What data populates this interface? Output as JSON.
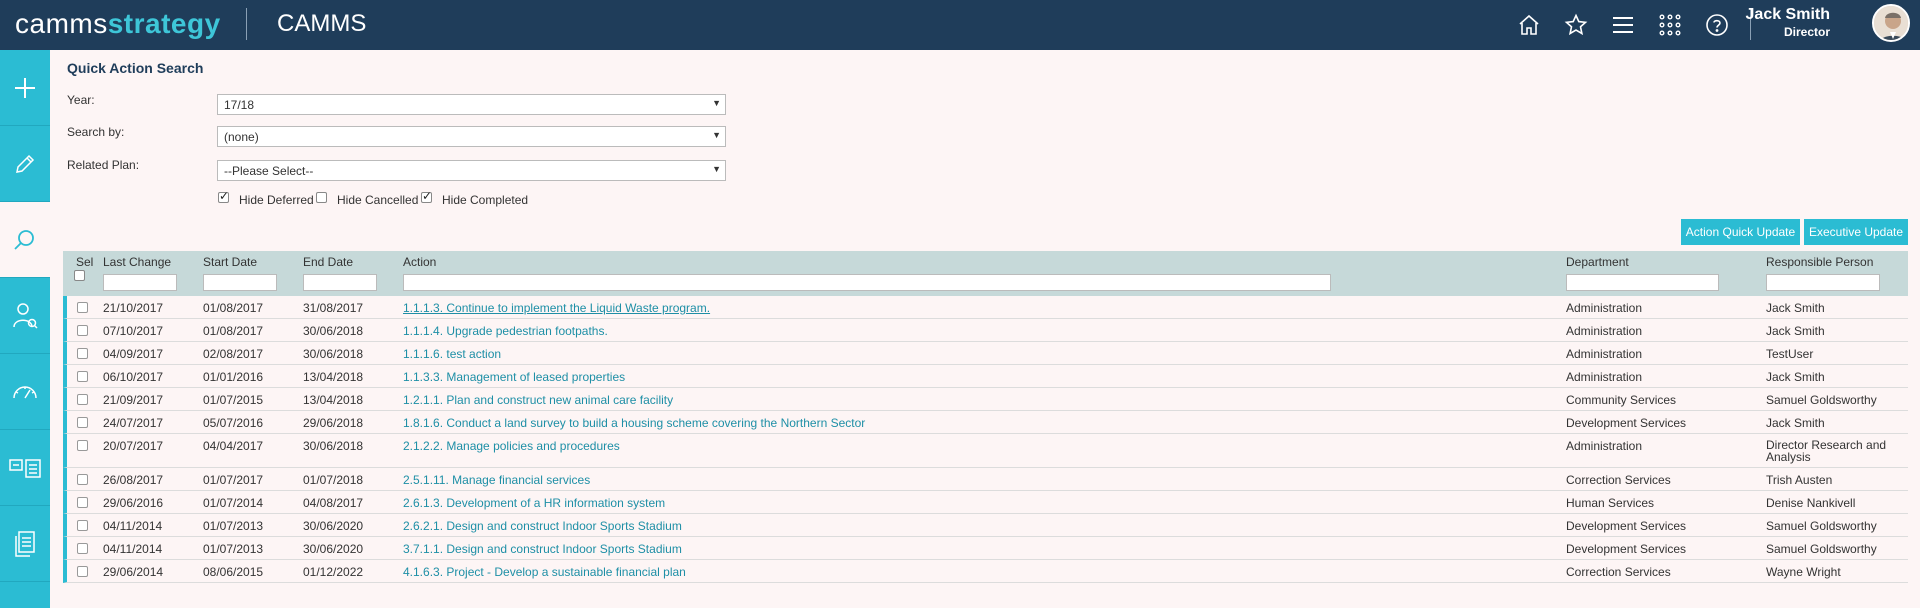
{
  "header": {
    "logo_part1": "camms",
    "logo_part2": "strategy",
    "app_title": "CAMMS",
    "user_name": "Jack Smith",
    "user_role": "Director"
  },
  "icons": {
    "top": [
      "home-icon",
      "star-icon",
      "menu-icon",
      "apps-grid-icon",
      "help-icon"
    ],
    "sidebar": [
      "plus-icon",
      "pencil-icon",
      "search-icon",
      "user-search-icon",
      "dashboard-gauge-icon",
      "report-cards-icon",
      "document-icon"
    ]
  },
  "colors": {
    "topbar": "#1f3d5a",
    "accent": "#2bbcd3",
    "link": "#1e8fa6"
  },
  "form": {
    "title": "Quick Action Search",
    "year_label": "Year:",
    "year_value": "17/18",
    "search_by_label": "Search by:",
    "search_by_value": "(none)",
    "related_plan_label": "Related Plan:",
    "related_plan_value": "--Please Select--",
    "hide_deferred": "Hide Deferred",
    "hide_cancelled": "Hide Cancelled",
    "hide_completed": "Hide Completed",
    "hide_deferred_checked": true,
    "hide_cancelled_checked": false,
    "hide_completed_checked": true
  },
  "buttons": {
    "action_quick_update": "Action Quick Update",
    "executive_update": "Executive Update"
  },
  "table": {
    "columns": {
      "sel": "Sel",
      "last_change": "Last Change",
      "start_date": "Start Date",
      "end_date": "End Date",
      "action": "Action",
      "department": "Department",
      "responsible": "Responsible Person"
    },
    "rows": [
      {
        "last_change": "21/10/2017",
        "start": "01/08/2017",
        "end": "31/08/2017",
        "action": "1.1.1.3. Continue to implement the Liquid Waste program.",
        "department": "Administration",
        "person": "Jack Smith"
      },
      {
        "last_change": "07/10/2017",
        "start": "01/08/2017",
        "end": "30/06/2018",
        "action": "1.1.1.4. Upgrade pedestrian footpaths.",
        "department": "Administration",
        "person": "Jack Smith"
      },
      {
        "last_change": "04/09/2017",
        "start": "02/08/2017",
        "end": "30/06/2018",
        "action": "1.1.1.6. test action",
        "department": "Administration",
        "person": "TestUser"
      },
      {
        "last_change": "06/10/2017",
        "start": "01/01/2016",
        "end": "13/04/2018",
        "action": "1.1.3.3. Management of leased properties",
        "department": "Administration",
        "person": "Jack Smith"
      },
      {
        "last_change": "21/09/2017",
        "start": "01/07/2015",
        "end": "13/04/2018",
        "action": "1.2.1.1. Plan and construct new animal care facility",
        "department": "Community Services",
        "person": "Samuel Goldsworthy"
      },
      {
        "last_change": "24/07/2017",
        "start": "05/07/2016",
        "end": "29/06/2018",
        "action": "1.8.1.6. Conduct a land survey to build a housing scheme covering the Northern Sector",
        "department": "Development Services",
        "person": "Jack Smith"
      },
      {
        "last_change": "20/07/2017",
        "start": "04/04/2017",
        "end": "30/06/2018",
        "action": "2.1.2.2. Manage policies and procedures",
        "department": "Administration",
        "person": "Director Research and Analysis"
      },
      {
        "last_change": "26/08/2017",
        "start": "01/07/2017",
        "end": "01/07/2018",
        "action": "2.5.1.11. Manage financial services",
        "department": "Correction Services",
        "person": "Trish Austen"
      },
      {
        "last_change": "29/06/2016",
        "start": "01/07/2014",
        "end": "04/08/2017",
        "action": "2.6.1.3. Development of a HR information system",
        "department": "Human Services",
        "person": "Denise Nankivell"
      },
      {
        "last_change": "04/11/2014",
        "start": "01/07/2013",
        "end": "30/06/2020",
        "action": "2.6.2.1. Design and construct Indoor Sports Stadium",
        "department": "Development Services",
        "person": "Samuel Goldsworthy"
      },
      {
        "last_change": "04/11/2014",
        "start": "01/07/2013",
        "end": "30/06/2020",
        "action": "3.7.1.1. Design and construct Indoor Sports Stadium",
        "department": "Development Services",
        "person": "Samuel Goldsworthy"
      },
      {
        "last_change": "29/06/2014",
        "start": "08/06/2015",
        "end": "01/12/2022",
        "action": "4.1.6.3. Project - Develop a sustainable financial plan",
        "department": "Correction Services",
        "person": "Wayne Wright"
      }
    ]
  }
}
